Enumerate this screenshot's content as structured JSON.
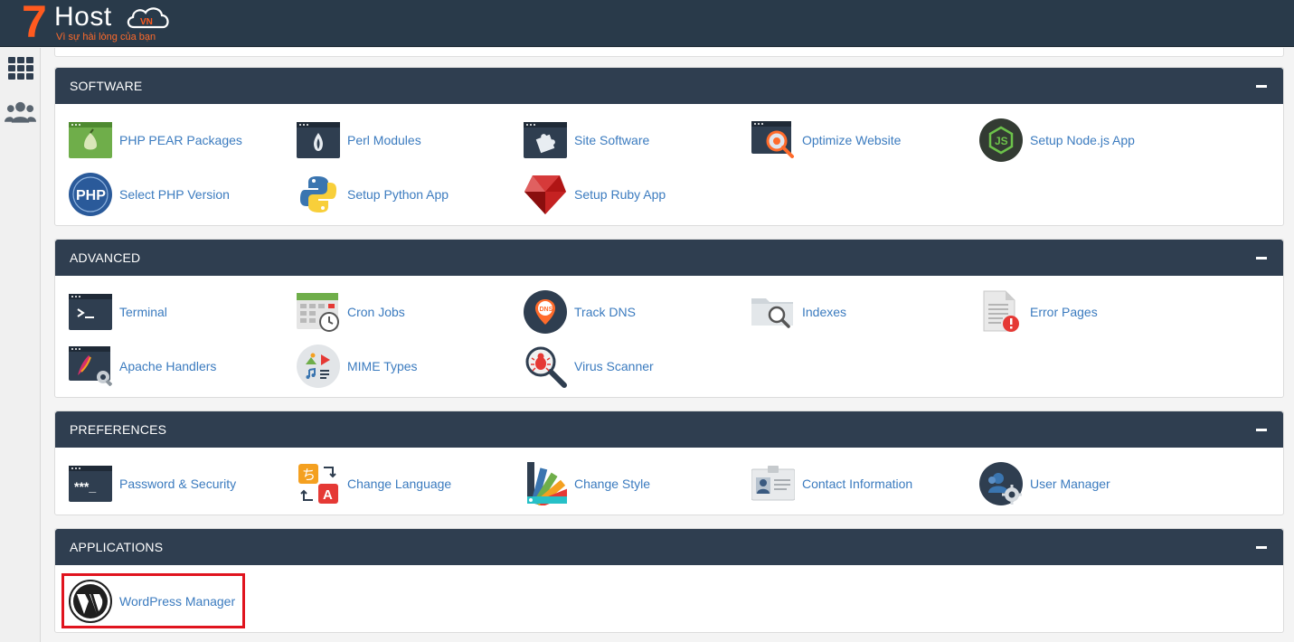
{
  "brand": {
    "number": "7",
    "name": "Host",
    "badge": "VN",
    "tagline": "Vì sự hài lòng của bạn",
    "colors": {
      "orange": "#ff5a1f",
      "topbar": "#293a4a",
      "panel_header": "#2f3e50",
      "link": "#3b7bbf",
      "highlight": "#e0141e"
    }
  },
  "sidebar": {
    "items": [
      {
        "icon": "grid-icon"
      },
      {
        "icon": "users-icon"
      }
    ]
  },
  "sections": {
    "software": {
      "title": "SOFTWARE",
      "items": [
        {
          "label": "PHP PEAR Packages",
          "icon": "php-pear-icon"
        },
        {
          "label": "Perl Modules",
          "icon": "perl-modules-icon"
        },
        {
          "label": "Site Software",
          "icon": "site-software-icon"
        },
        {
          "label": "Optimize Website",
          "icon": "optimize-website-icon"
        },
        {
          "label": "Setup Node.js App",
          "icon": "nodejs-icon"
        },
        {
          "label": "Select PHP Version",
          "icon": "php-version-icon"
        },
        {
          "label": "Setup Python App",
          "icon": "python-icon"
        },
        {
          "label": "Setup Ruby App",
          "icon": "ruby-icon"
        }
      ]
    },
    "advanced": {
      "title": "ADVANCED",
      "items": [
        {
          "label": "Terminal",
          "icon": "terminal-icon"
        },
        {
          "label": "Cron Jobs",
          "icon": "cron-jobs-icon"
        },
        {
          "label": "Track DNS",
          "icon": "track-dns-icon"
        },
        {
          "label": "Indexes",
          "icon": "indexes-icon"
        },
        {
          "label": "Error Pages",
          "icon": "error-pages-icon"
        },
        {
          "label": "Apache Handlers",
          "icon": "apache-handlers-icon"
        },
        {
          "label": "MIME Types",
          "icon": "mime-types-icon"
        },
        {
          "label": "Virus Scanner",
          "icon": "virus-scanner-icon"
        }
      ]
    },
    "preferences": {
      "title": "PREFERENCES",
      "items": [
        {
          "label": "Password & Security",
          "icon": "password-security-icon"
        },
        {
          "label": "Change Language",
          "icon": "change-language-icon"
        },
        {
          "label": "Change Style",
          "icon": "change-style-icon"
        },
        {
          "label": "Contact Information",
          "icon": "contact-information-icon"
        },
        {
          "label": "User Manager",
          "icon": "user-manager-icon"
        }
      ]
    },
    "applications": {
      "title": "APPLICATIONS",
      "items": [
        {
          "label": "WordPress Manager",
          "icon": "wordpress-icon"
        }
      ]
    }
  }
}
